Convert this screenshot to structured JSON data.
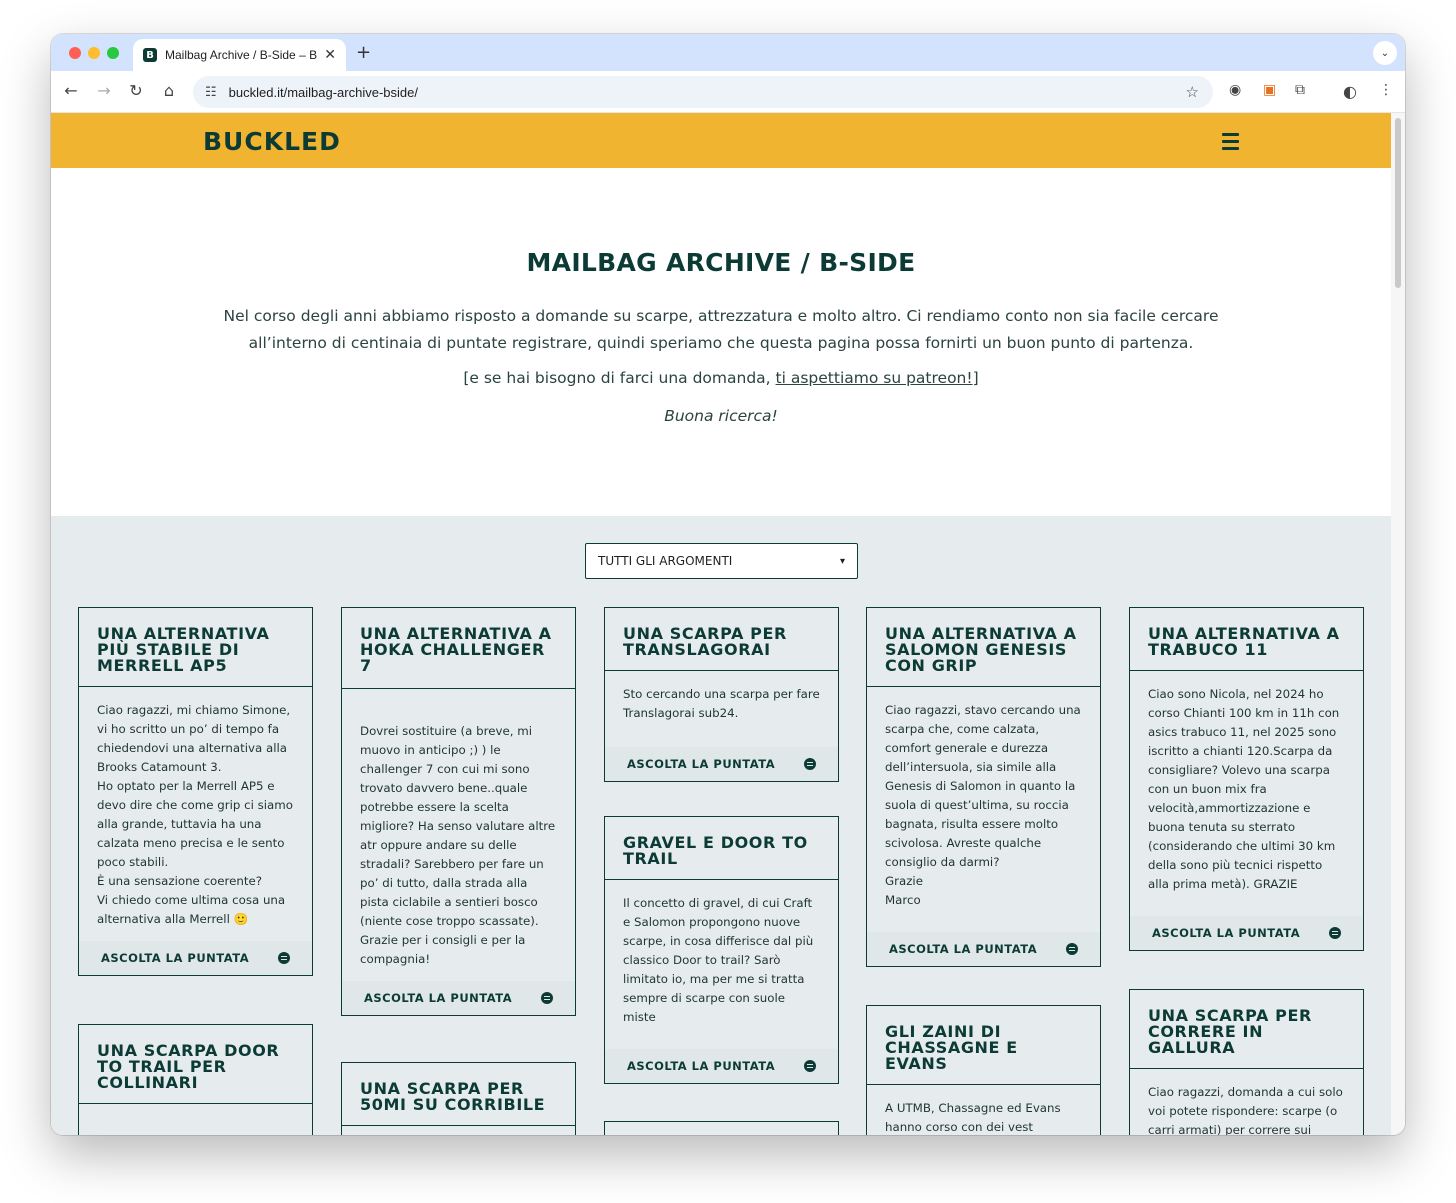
{
  "browser": {
    "tab_title": "Mailbag Archive / B-Side – Buckled",
    "tab_close": "✕",
    "new_tab": "+",
    "url": "buckled.it/mailbag-archive-bside/"
  },
  "site": {
    "logo": "BUCKLED"
  },
  "intro": {
    "title": "MAILBAG ARCHIVE / B-SIDE",
    "text": "Nel corso degli anni abbiamo risposto a domande su scarpe, attrezzatura e molto altro. Ci rendiamo conto non sia facile cercare all’interno di centinaia di puntate registrare, quindi speriamo che questa pagina possa fornirti un buon punto di partenza.",
    "ask_prefix": "[e se hai bisogno di farci una domanda, ",
    "ask_link": "ti aspettiamo su patreon!",
    "ask_suffix": "]",
    "closing": "Buona ricerca!"
  },
  "filter": {
    "selected": "TUTTI GLI ARGOMENTI"
  },
  "cta_label": "ASCOLTA LA PUNTATA",
  "cards": [
    {
      "title": "UNA ALTERNATIVA PIÙ STABILE DI MERRELL AP5",
      "body": "Ciao ragazzi, mi chiamo Simone, vi ho scritto un po’ di tempo fa chiedendovi una alternativa alla Brooks Catamount 3.\nHo optato per la Merrell AP5 e devo dire che come grip ci siamo alla grande, tuttavia ha una calzata meno precisa e le sento poco stabili.\nÈ una sensazione coerente?\nVi chiedo come ultima cosa una alternativa alla Merrell 🙂"
    },
    {
      "title": "UNA ALTERNATIVA A HOKA CHALLENGER 7",
      "body": "Dovrei sostituire (a breve, mi muovo in anticipo ;) ) le challenger 7 con cui mi sono trovato davvero bene..quale potrebbe essere la scelta migliore? Ha senso valutare altre atr oppure andare su delle stradali? Sarebbero per fare un po’ di tutto, dalla strada alla pista ciclabile a sentieri bosco (niente cose troppo scassate). Grazie per i consigli e per la compagnia!"
    },
    {
      "title": "UNA SCARPA PER TRANSLAGORAI",
      "body": "Sto cercando una scarpa per fare Translagorai sub24."
    },
    {
      "title": "UNA ALTERNATIVA A SALOMON GENESIS CON GRIP",
      "body": "Ciao ragazzi, stavo cercando una scarpa che, come calzata, comfort generale e durezza dell’intersuola, sia simile alla Genesis di Salomon in quanto la suola di quest’ultima, su roccia bagnata, risulta essere molto scivolosa. Avreste qualche consiglio da darmi?\nGrazie\nMarco"
    },
    {
      "title": "UNA ALTERNATIVA A TRABUCO 11",
      "body": "Ciao sono Nicola, nel 2024 ho corso Chianti 100 km in 11h con asics trabuco 11, nel 2025 sono iscritto a chianti 120.Scarpa da consigliare? Volevo una scarpa con un buon mix fra velocità,ammortizzazione e buona tenuta su sterrato (considerando che ultimi 30 km della sono più tecnici rispetto alla prima metà). GRAZIE"
    },
    {
      "title": "GRAVEL E DOOR TO TRAIL",
      "body": "Il concetto di gravel, di cui Craft e Salomon propongono nuove scarpe, in cosa differisce dal più classico Door to trail? Sarò limitato io, ma per me si tratta sempre di scarpe con suole miste"
    },
    {
      "title": "UNA SCARPA DOOR TO TRAIL PER COLLINARI",
      "body": ""
    },
    {
      "title": "UNA SCARPA PER 50MI SU CORRIBILE",
      "body": ""
    },
    {
      "title": "GLI ZAINI DI CHASSAGNE E EVANS",
      "body": "A UTMB, Chassagne ed Evans hanno corso con dei vest"
    },
    {
      "title": "UNA SCARPA PER CORRERE IN GALLURA",
      "body": "Ciao ragazzi, domanda a cui solo voi potete rispondere: scarpe (o carri armati) per correre sui"
    }
  ]
}
